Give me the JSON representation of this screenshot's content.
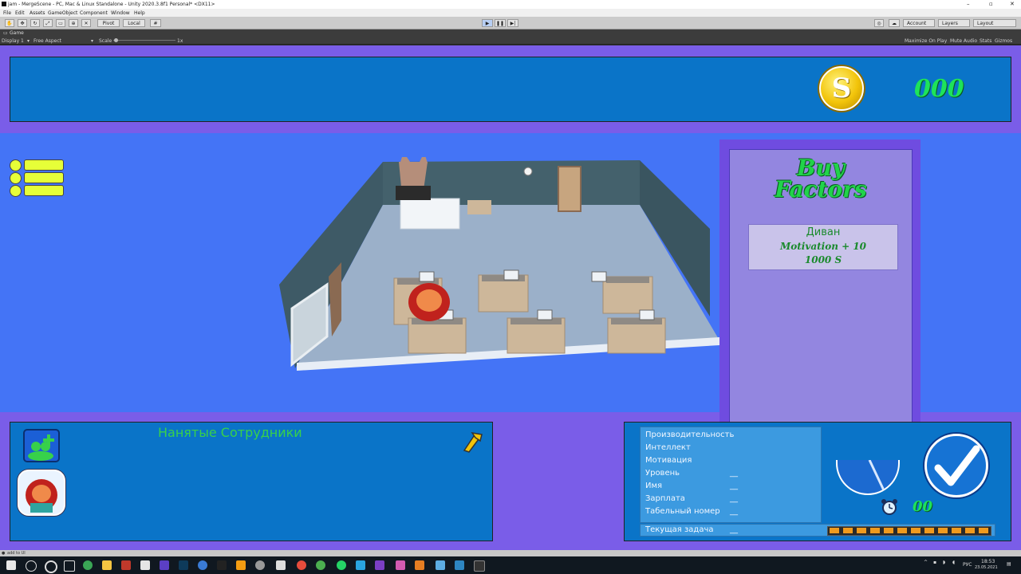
{
  "window": {
    "title": "jam - MergeScene - PC, Mac & Linux Standalone - Unity 2020.3.8f1 Personal* <DX11>"
  },
  "menu": [
    "File",
    "Edit",
    "Assets",
    "GameObject",
    "Component",
    "Window",
    "Help"
  ],
  "toolbar": {
    "pivot": "Pivot",
    "local": "Local",
    "account": "Account",
    "layers": "Layers",
    "layout": "Layout"
  },
  "game_tab": {
    "label": "Game"
  },
  "game_bar": {
    "display": "Display 1",
    "aspect": "Free Aspect",
    "scale_label": "Scale",
    "scale_value": "1x",
    "maximize": "Maximize On Play",
    "mute": "Mute Audio",
    "stats": "Stats",
    "gizmos": "Gizmos"
  },
  "hud": {
    "coin_symbol": "S",
    "money": "000"
  },
  "buy_panel": {
    "title_line1": "Buy",
    "title_line2": "Factors",
    "factor": {
      "name": "Диван",
      "motivation": "Motivation +  10",
      "price": "1000     S"
    }
  },
  "employees": {
    "title": "Нанятые Сотрудники"
  },
  "stats": [
    {
      "label": "Производительность",
      "value": ""
    },
    {
      "label": "Интеллект",
      "value": ""
    },
    {
      "label": "Мотивация",
      "value": ""
    },
    {
      "label": "Уровень",
      "value": "__"
    },
    {
      "label": "Имя",
      "value": "__"
    },
    {
      "label": "Зарплата",
      "value": "__"
    },
    {
      "label": "Табельный номер",
      "value": "__"
    }
  ],
  "task": {
    "label": "Текущая задача",
    "value": "__"
  },
  "timer": {
    "value": "00"
  },
  "status_bar": {
    "text": "add to UI"
  },
  "tray": {
    "lang": "РУС",
    "time": "18:53",
    "date": "23.05.2021"
  },
  "colors": {
    "sky": "#4474f6",
    "panel": "#0a74c8",
    "purple": "#7a5de8",
    "accent_green": "#1ee35a"
  }
}
